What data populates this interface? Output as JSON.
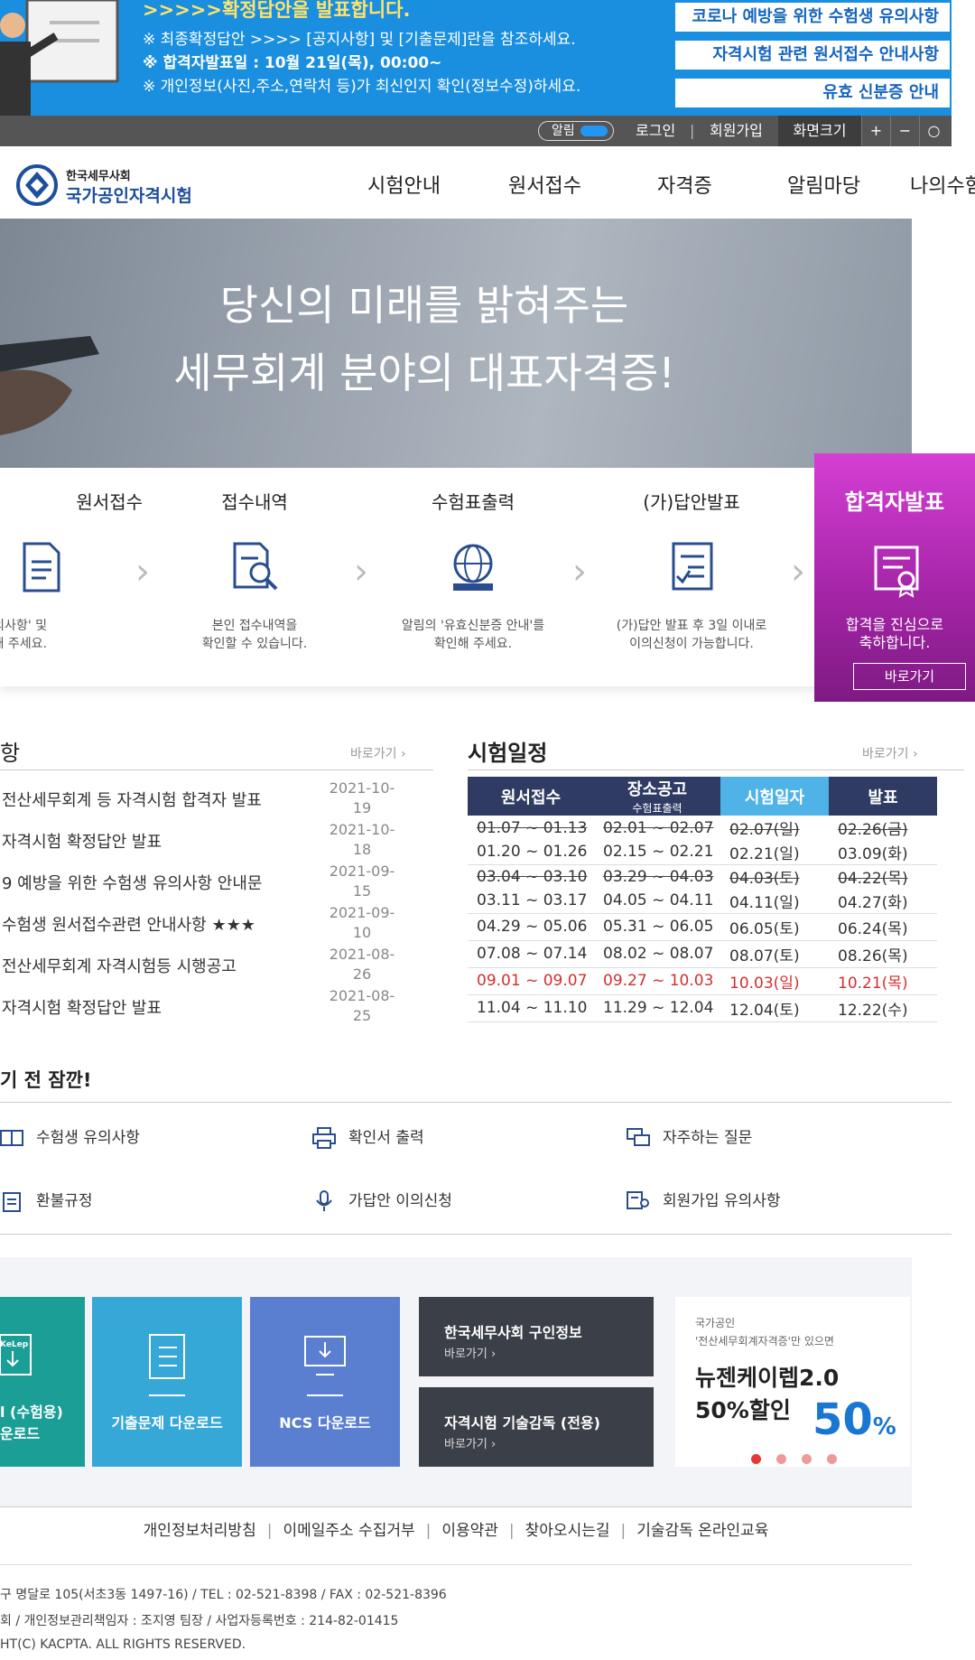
{
  "notice": {
    "line1": ">>>>>확정답안을 발표합니다.",
    "line2": "※ 최종확정답안 >>>> [공지사항] 및 [기출문제]란을 참조하세요.",
    "line3": "※ 합격자발표일 : 10월 21일(목), 00:00~",
    "line4": "※ 개인정보(사진,주소,연락처 등)가 최신인지 확인(정보수정)하세요.",
    "links": [
      "코로나 예방을 위한 수험생 유의사항",
      "자격시험 관련 원서접수 안내사항",
      "유효 신분증 안내"
    ]
  },
  "util": {
    "alarm": "알림",
    "login": "로그인",
    "join": "회원가입",
    "zoom_label": "화면크기",
    "zoom_in": "+",
    "zoom_out": "−",
    "zoom_reset": "○"
  },
  "logo": {
    "org": "한국세무사회",
    "name": "국가공인자격시험"
  },
  "nav": [
    "시험안내",
    "원서접수",
    "자격증",
    "알림마당",
    "나의수험"
  ],
  "hero": {
    "line1": "당신의 미래를 밝혀주는",
    "line2": "세무회계 분야의 대표자격증!"
  },
  "steps": [
    {
      "title": "원서접수",
      "desc1": "원서접수 유의사항' 및",
      "desc2": "내'를 확인해 주세요."
    },
    {
      "title": "접수내역",
      "desc1": "본인 접수내역을",
      "desc2": "확인할 수 있습니다."
    },
    {
      "title": "수험표출력",
      "desc1": "알림의 '유효신분증 안내'를",
      "desc2": "확인해 주세요."
    },
    {
      "title": "(가)답안발표",
      "desc1": "(가)답안 발표 후 3일 이내로",
      "desc2": "이의신청이 가능합니다."
    }
  ],
  "winner": {
    "title": "합격자발표",
    "desc1": "합격을 진심으로",
    "desc2": "축하합니다.",
    "button": "바로가기"
  },
  "notices": {
    "title": "항",
    "more": "바로가기 ›",
    "items": [
      {
        "title": "전산세무회계 등 자격시험 합격자 발표",
        "date1": "2021-10-",
        "date2": "19"
      },
      {
        "title": "자격시험 확정답안 발표",
        "date1": "2021-10-",
        "date2": "18"
      },
      {
        "title": "9 예방을 위한 수험생 유의사항 안내문",
        "date1": "2021-09-",
        "date2": "15"
      },
      {
        "title": "수험생 원서접수관련 안내사항 ★★★",
        "date1": "2021-09-",
        "date2": "10"
      },
      {
        "title": "전산세무회계 자격시험등 시행공고",
        "date1": "2021-08-",
        "date2": "26"
      },
      {
        "title": "자격시험 확정답안 발표",
        "date1": "2021-08-",
        "date2": "25"
      }
    ]
  },
  "schedule": {
    "title": "시험일정",
    "more": "바로가기 ›",
    "headers": {
      "apply": "원서접수",
      "venue": "장소공고",
      "venue_sub": "수험표출력",
      "exam": "시험일자",
      "result": "발표"
    },
    "rows": [
      {
        "apply": "01.07 ~ 01.13",
        "venue": "02.01 ~ 02.07",
        "exam": "02.07(일)",
        "result": "02.26(금)",
        "strike": true
      },
      {
        "apply": "01.20 ~ 01.26",
        "venue": "02.15 ~ 02.21",
        "exam": "02.21(일)",
        "result": "03.09(화)"
      },
      {
        "apply": "03.04 ~ 03.10",
        "venue": "03.29 ~ 04.03",
        "exam": "04.03(토)",
        "result": "04.22(목)",
        "strike": true
      },
      {
        "apply": "03.11 ~ 03.17",
        "venue": "04.05 ~ 04.11",
        "exam": "04.11(일)",
        "result": "04.27(화)"
      },
      {
        "apply": "04.29 ~ 05.06",
        "venue": "05.31 ~ 06.05",
        "exam": "06.05(토)",
        "result": "06.24(목)"
      },
      {
        "apply": "07.08 ~ 07.14",
        "venue": "08.02 ~ 08.07",
        "exam": "08.07(토)",
        "result": "08.26(목)"
      },
      {
        "apply": "09.01 ~ 09.07",
        "venue": "09.27 ~ 10.03",
        "exam": "10.03(일)",
        "result": "10.21(목)",
        "highlight": true
      },
      {
        "apply": "11.04 ~ 11.10",
        "venue": "11.29 ~ 12.04",
        "exam": "12.04(토)",
        "result": "12.22(수)"
      }
    ]
  },
  "quick": {
    "title": "기 전 잠깐!",
    "items": [
      "수험생 유의사항",
      "확인서 출력",
      "자주하는 질문",
      "환불규정",
      "가답안 이의신청",
      "회원가입 유의사항"
    ]
  },
  "banners": {
    "b1_line1": "l (수험용)",
    "b1_line2": "운로드",
    "b1_logo": "KeLep",
    "b2": "기출문제 다운로드",
    "b3": "NCS 다운로드",
    "job": "한국세무사회 구인정보",
    "job_more": "바로가기 ›",
    "supervise": "자격시험 기술감독 (전용)",
    "supervise_more": "바로가기 ›",
    "ad_line1": "국가공인",
    "ad_line2": "'전산세무회계자격증'만 있으면",
    "ad_line3": "뉴젠케이렙2.0",
    "ad_line4": "50%할인",
    "ad_big": "50",
    "ad_pct": "%"
  },
  "footer": {
    "links": [
      "개인정보처리방침",
      "이메일주소 수집거부",
      "이용약관",
      "찾아오시는길",
      "기술감독 온라인교육"
    ],
    "addr1": "구 명달로 105(서초3동 1497-16) / TEL : 02-521-8398 / FAX : 02-521-8396",
    "addr2": "회 / 개인정보관리책임자 : 조지영 팀장 / 사업자등록번호 : 214-82-01415",
    "addr3": "HT(C) KACPTA. ALL RIGHTS RESERVED."
  },
  "colors": {
    "banner_blue": "#1a8fe0",
    "winner_magenta": "#b22bb5",
    "schedule_header": "#2f3b63",
    "schedule_exam_header": "#4fb3e8",
    "teal": "#1a9e96",
    "sky": "#35a8d8",
    "blue_tile": "#5b7fd0"
  }
}
